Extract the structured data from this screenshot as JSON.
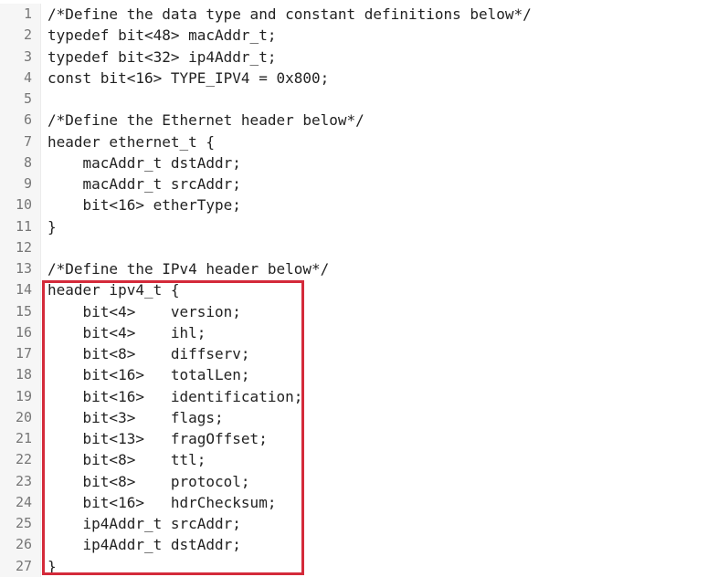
{
  "code_lines": [
    {
      "num": "1",
      "text": "/*Define the data type and constant definitions below*/"
    },
    {
      "num": "2",
      "text": "typedef bit<48> macAddr_t;"
    },
    {
      "num": "3",
      "text": "typedef bit<32> ip4Addr_t;"
    },
    {
      "num": "4",
      "text": "const bit<16> TYPE_IPV4 = 0x800;"
    },
    {
      "num": "5",
      "text": ""
    },
    {
      "num": "6",
      "text": "/*Define the Ethernet header below*/"
    },
    {
      "num": "7",
      "text": "header ethernet_t {"
    },
    {
      "num": "8",
      "text": "    macAddr_t dstAddr;"
    },
    {
      "num": "9",
      "text": "    macAddr_t srcAddr;"
    },
    {
      "num": "10",
      "text": "    bit<16> etherType;"
    },
    {
      "num": "11",
      "text": "}"
    },
    {
      "num": "12",
      "text": ""
    },
    {
      "num": "13",
      "text": "/*Define the IPv4 header below*/"
    },
    {
      "num": "14",
      "text": "header ipv4_t {"
    },
    {
      "num": "15",
      "text": "    bit<4>    version;"
    },
    {
      "num": "16",
      "text": "    bit<4>    ihl;"
    },
    {
      "num": "17",
      "text": "    bit<8>    diffserv;"
    },
    {
      "num": "18",
      "text": "    bit<16>   totalLen;"
    },
    {
      "num": "19",
      "text": "    bit<16>   identification;"
    },
    {
      "num": "20",
      "text": "    bit<3>    flags;"
    },
    {
      "num": "21",
      "text": "    bit<13>   fragOffset;"
    },
    {
      "num": "22",
      "text": "    bit<8>    ttl;"
    },
    {
      "num": "23",
      "text": "    bit<8>    protocol;"
    },
    {
      "num": "24",
      "text": "    bit<16>   hdrChecksum;"
    },
    {
      "num": "25",
      "text": "    ip4Addr_t srcAddr;"
    },
    {
      "num": "26",
      "text": "    ip4Addr_t dstAddr;"
    },
    {
      "num": "27",
      "text": "}"
    }
  ],
  "highlight_color": "#d42a3a"
}
